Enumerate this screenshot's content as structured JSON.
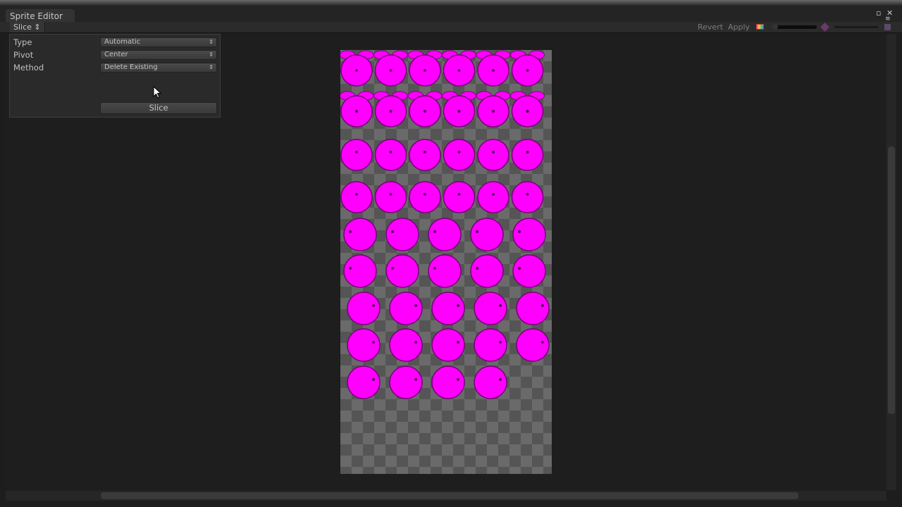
{
  "window": {
    "title": "Sprite Editor"
  },
  "toolbar": {
    "slice_menu": "Slice ⇕",
    "revert": "Revert",
    "apply": "Apply"
  },
  "slice_panel": {
    "fields": [
      {
        "label": "Type",
        "value": "Automatic"
      },
      {
        "label": "Pivot",
        "value": "Center"
      },
      {
        "label": "Method",
        "value": "Delete Existing"
      }
    ],
    "slice_button": "Slice"
  },
  "sprite_sheet": {
    "sprites_per_row": [
      6,
      6,
      6,
      6,
      5,
      5,
      5,
      5,
      4
    ],
    "sprite_color": "#ff00ff"
  }
}
